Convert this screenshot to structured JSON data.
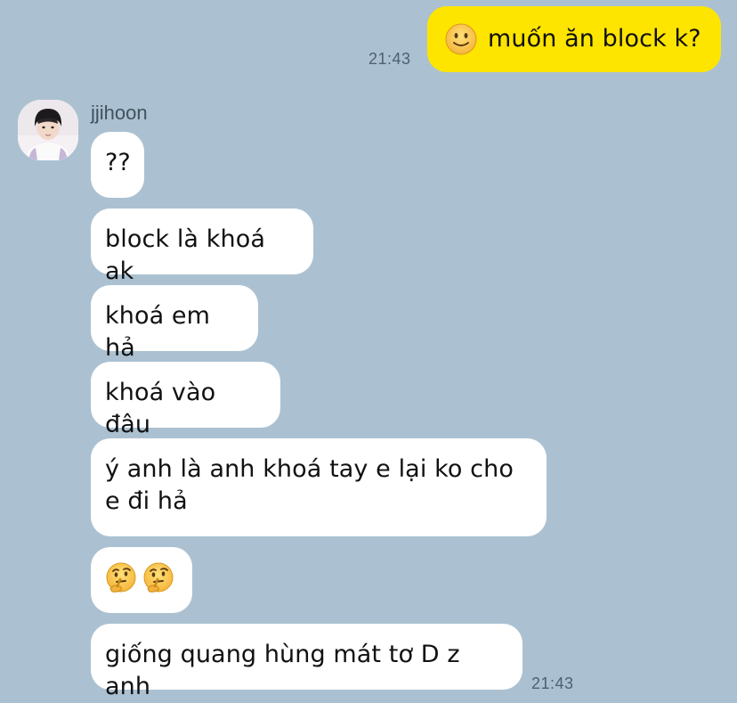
{
  "outgoing": {
    "text": "muốn ăn block k?",
    "emoji_icon": "slightly-smiling-face-icon",
    "time": "21:43"
  },
  "incoming": {
    "sender": "jjihoon",
    "avatar": "profile-photo",
    "time": "21:43",
    "messages": [
      "??",
      "block là khoá ak",
      "khoá em hả",
      "khoá vào đâu",
      "ý anh là anh khoá tay e lại ko cho e đi hả",
      "",
      "giống quang hùng mát tơ D z anh"
    ],
    "emoji_message_icons": [
      "thinking-face-icon",
      "thinking-face-icon"
    ]
  },
  "colors": {
    "background": "#abc1d1",
    "outgoing_bubble": "#fee500",
    "incoming_bubble": "#ffffff",
    "time_text": "#4f6070"
  }
}
